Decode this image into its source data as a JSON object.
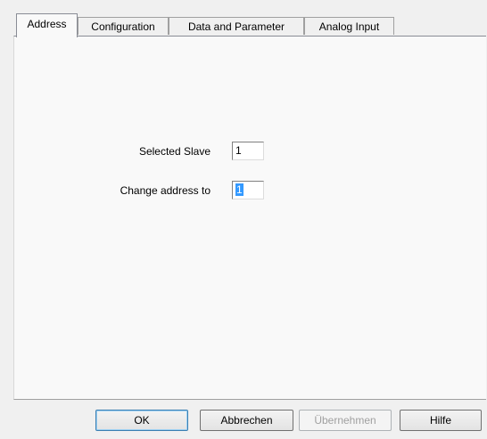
{
  "tabs": [
    {
      "label": "Address",
      "active": true
    },
    {
      "label": "Configuration",
      "active": false
    },
    {
      "label": "Data and Parameter",
      "active": false
    },
    {
      "label": "Analog Input",
      "active": false
    }
  ],
  "address": {
    "selected_slave_label": "Selected Slave",
    "selected_slave_value": "1",
    "change_address_label": "Change address to",
    "change_address_value": "1"
  },
  "buttons": {
    "ok": "OK",
    "cancel": "Abbrechen",
    "apply": "Übernehmen",
    "help": "Hilfe"
  },
  "colors": {
    "selection_highlight": "#3399ff",
    "panel_background": "#f9f9f9",
    "dialog_background": "#f0f0f0"
  }
}
